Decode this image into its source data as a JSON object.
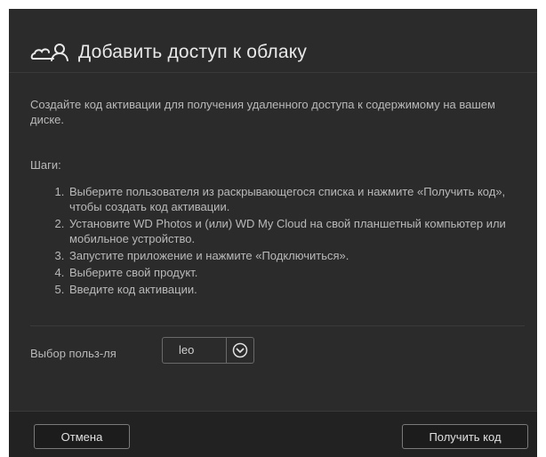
{
  "dialog": {
    "title": "Добавить доступ к облаку",
    "icon": "cloud-user-icon",
    "intro": "Создайте код активации для получения удаленного доступа к содержимому на вашем диске.",
    "steps_label": "Шаги:",
    "steps": [
      "Выберите пользователя из раскрывающегося списка и нажмите «Получить код», чтобы создать код активации.",
      "Установите WD Photos и (или) WD My Cloud на свой планшетный компьютер или мобильное устройство.",
      "Запустите приложение и нажмите «Подключиться».",
      "Выберите свой продукт.",
      "Введите код активации."
    ],
    "user_select": {
      "label": "Выбор польз-ля",
      "value": "leo",
      "arrow_icon": "chevron-down-circle-icon"
    }
  },
  "footer": {
    "cancel_label": "Отмена",
    "get_code_label": "Получить код"
  },
  "colors": {
    "background": "#2b2b2b",
    "footer": "#222222",
    "text": "#b9b9b9",
    "title": "#e8e8e8"
  }
}
